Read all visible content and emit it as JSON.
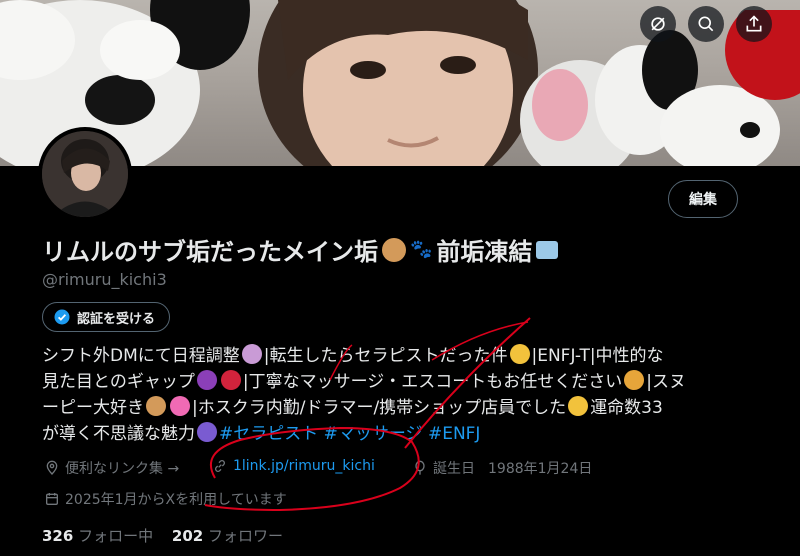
{
  "profile": {
    "display_name": "リムルのサブ垢だったメイン垢",
    "display_name_suffix": "前垢凍結",
    "handle": "@rimuru_kichi3",
    "edit_label": "編集",
    "verify_label": "認証を受ける",
    "bio": {
      "line1_a": "シフト外DMにて日程調整",
      "line1_b": "|転生したらセラピストだった件",
      "line1_c": "|ENFJ-T|中性的な",
      "line2_a": "見た目とのギャップ",
      "line2_b": "|丁寧なマッサージ・エスコートもお任せください",
      "line2_c": "|スヌ",
      "line3_a": "ーピー大好き",
      "line3_b": "|ホスクラ内勤/ドラマー/携帯ショップ店員でした",
      "line3_c": "運命数33",
      "line4_a": "が導く不思議な魅力",
      "hashtags": "#セラピスト #マッサージ #ENFJ"
    },
    "meta": {
      "links_label": "便利なリンク集 →",
      "url": "1link.jp/rimuru_kichi",
      "birthday_label": "誕生日",
      "birthday": "1988年1月24日",
      "joined": "2025年1月からXを利用しています"
    },
    "following_count": "326",
    "following_label": "フォロー中",
    "followers_count": "202",
    "followers_label": "フォロワー"
  },
  "colors": {
    "accent": "#1d9bf0",
    "muted": "#71767b",
    "annotation": "#d9001b"
  },
  "icons": [
    "no-link-icon",
    "search-icon",
    "share-icon",
    "verified-badge-icon",
    "location-icon",
    "link-icon",
    "balloon-icon",
    "calendar-icon"
  ]
}
